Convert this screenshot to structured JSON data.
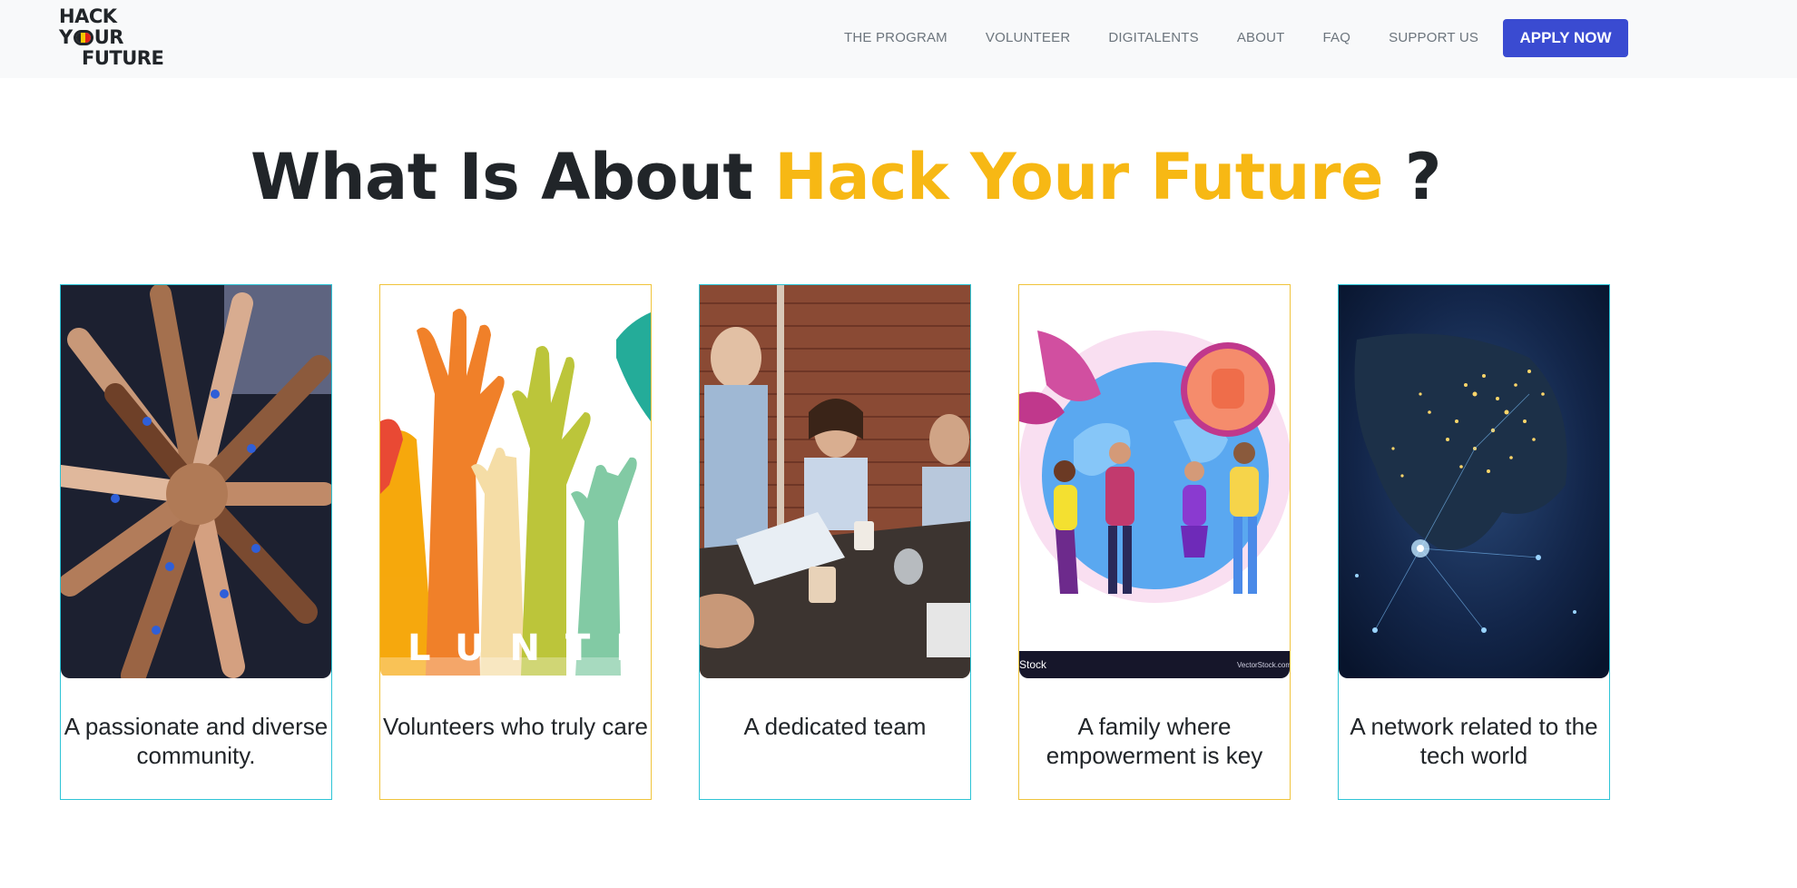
{
  "header": {
    "logo": {
      "line1": "HACK",
      "line2_a": "Y",
      "line2_b": "UR",
      "line3": "FUTURE"
    },
    "nav": [
      "THE PROGRAM",
      "VOLUNTEER",
      "DIGITALENTS",
      "ABOUT",
      "FAQ",
      "SUPPORT US"
    ],
    "cta_label": "APPLY NOW",
    "cta_color": "#3a4bd1"
  },
  "hero": {
    "title_prefix": "What Is About",
    "title_accent": "Hack Your Future",
    "title_suffix": "?",
    "accent_color": "#f7b814"
  },
  "cards": [
    {
      "caption": "A passionate and diverse community.",
      "image": "hands-together-photo",
      "border_color": "#2ec4d6"
    },
    {
      "caption": "Volunteers who truly care",
      "image": "raised-hands-illustration",
      "image_text": "LUNTE",
      "border_color": "#f0c43c"
    },
    {
      "caption": "A dedicated team",
      "image": "team-meeting-photo",
      "border_color": "#2ec4d6"
    },
    {
      "caption": "A family where empowerment is key",
      "image": "empowerment-illustration",
      "image_text_left": "Stock",
      "image_text_right": "VectorStock.com",
      "border_color": "#f0c43c"
    },
    {
      "caption": "A network related to the tech world",
      "image": "earth-night-lights-photo",
      "border_color": "#2ec4d6"
    }
  ]
}
